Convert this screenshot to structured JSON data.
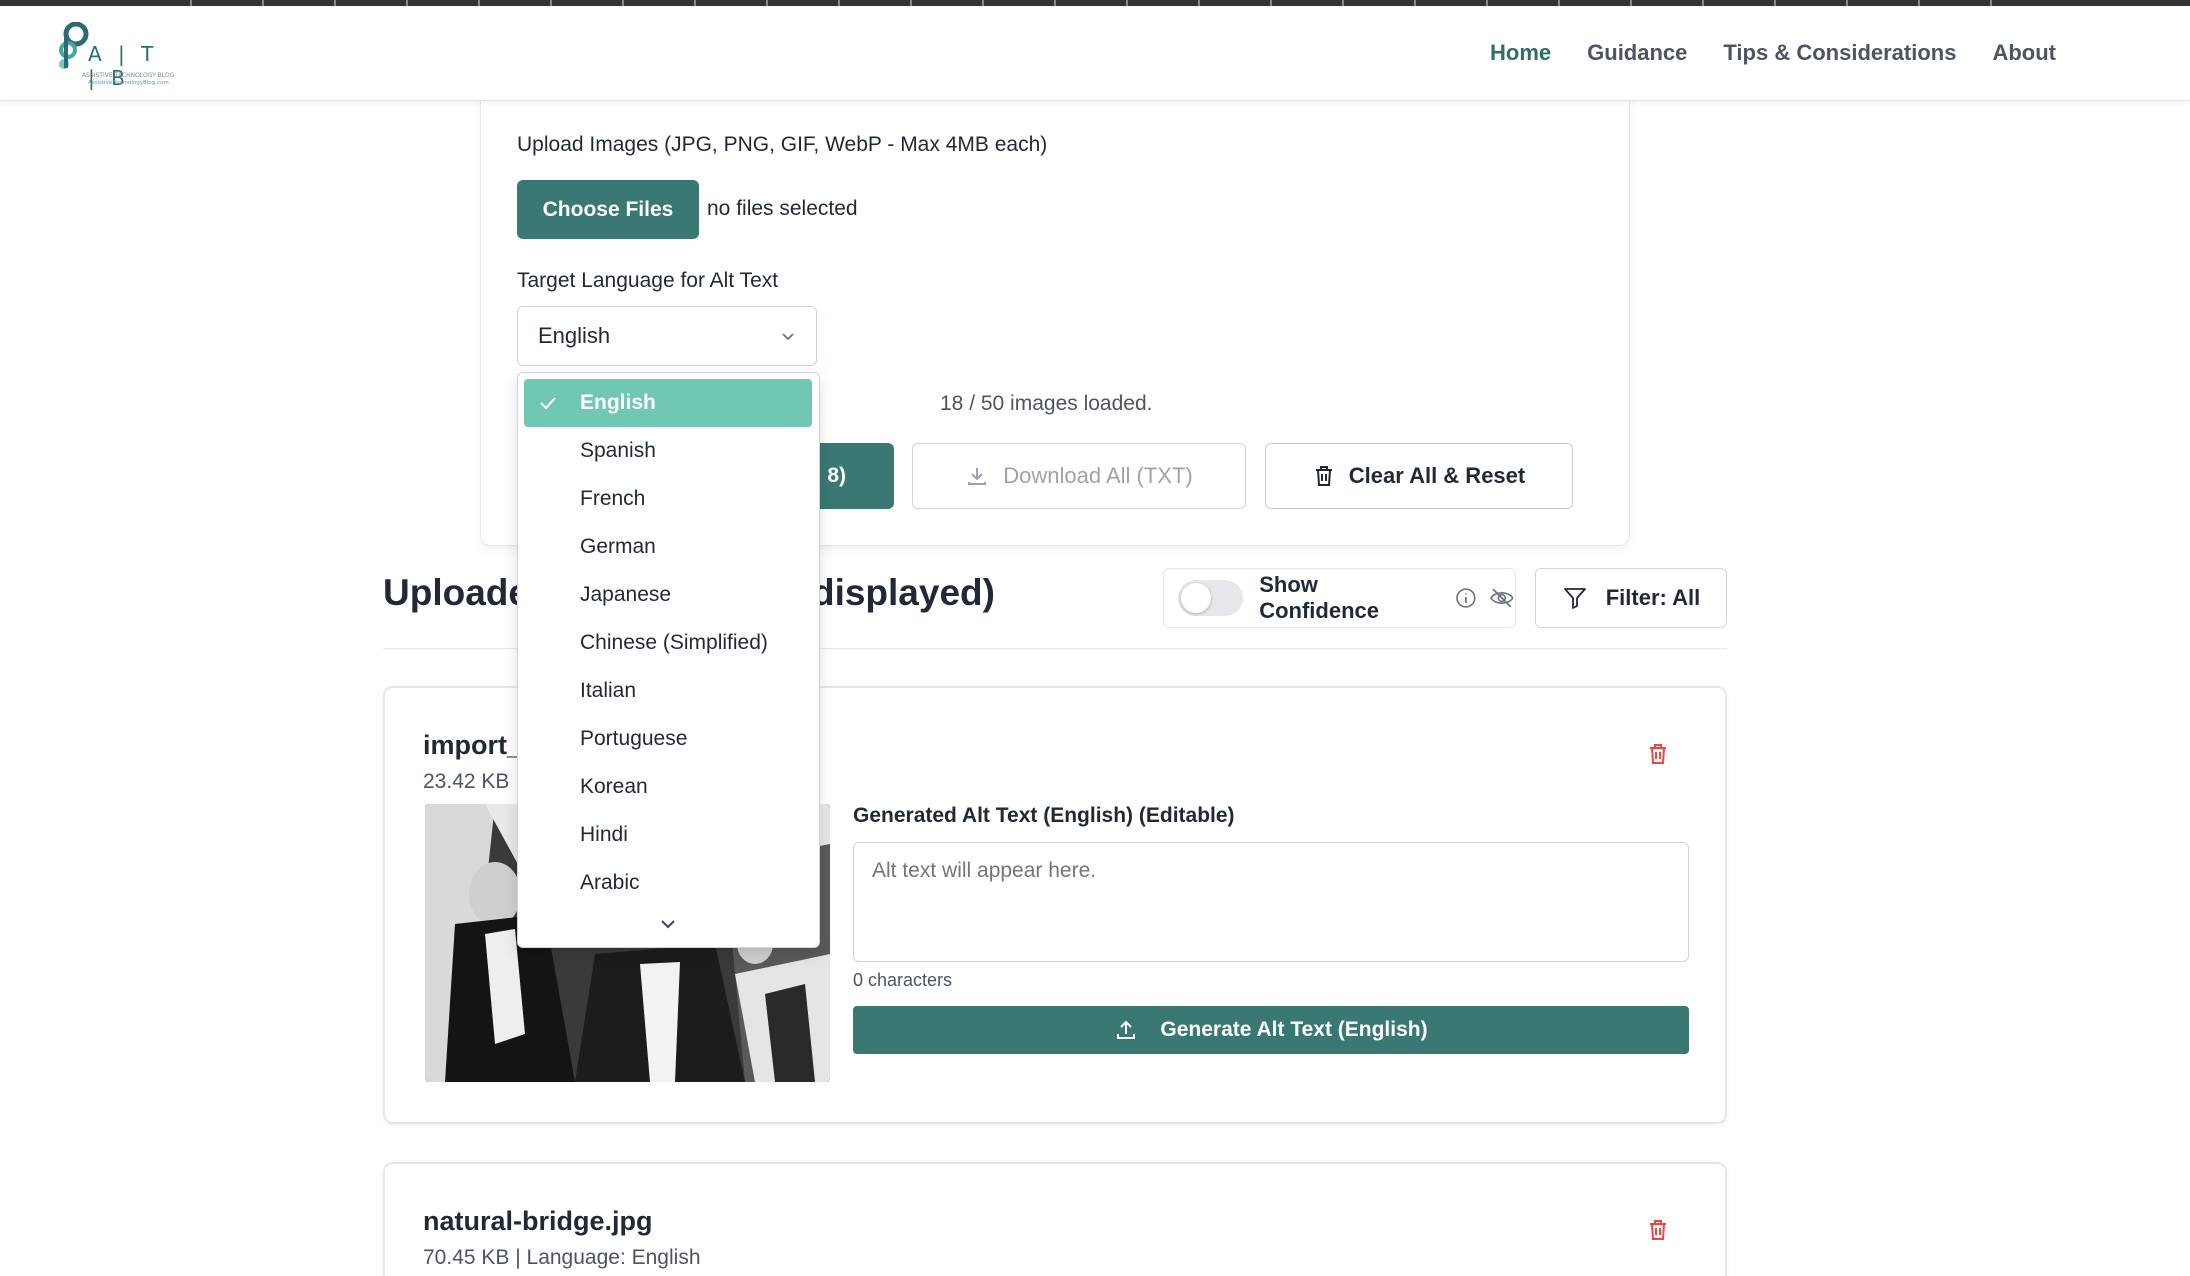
{
  "nav": {
    "logo_letters": "A | T | B",
    "logo_tagline": "ASSISTIVE TECHNOLOGY BLOG",
    "logo_url": "AssistiveTechnologyBlog.com",
    "home": "Home",
    "guidance": "Guidance",
    "tips": "Tips & Considerations",
    "about": "About"
  },
  "upload": {
    "label": "Upload Images (JPG, PNG, GIF, WebP - Max 4MB each)",
    "choose_files": "Choose Files",
    "no_files": "no files selected"
  },
  "language": {
    "label": "Target Language for Alt Text",
    "selected": "English",
    "options": [
      "English",
      "Spanish",
      "French",
      "German",
      "Japanese",
      "Chinese (Simplified)",
      "Italian",
      "Portuguese",
      "Korean",
      "Hindi",
      "Arabic"
    ]
  },
  "status": {
    "images_loaded": "18 / 50 images loaded."
  },
  "actions": {
    "generate_all_suffix": "8)",
    "download_all": "Download All (TXT)",
    "clear_all": "Clear All & Reset"
  },
  "section": {
    "title_left": "Uploade",
    "title_right": "displayed)",
    "show_confidence": "Show Confidence",
    "filter": "Filter: All"
  },
  "cards": [
    {
      "filename": "import_",
      "meta": "23.42 KB",
      "alt_label": "Generated Alt Text (English) (Editable)",
      "alt_placeholder": "Alt text will appear here.",
      "char_count": "0 characters",
      "generate": "Generate Alt Text (English)"
    },
    {
      "filename": "natural-bridge.jpg",
      "meta": "70.45 KB | Language: English"
    }
  ],
  "colors": {
    "primary": "#3a7873",
    "selected_option": "#6fc7b4",
    "delete": "#ef4444"
  }
}
